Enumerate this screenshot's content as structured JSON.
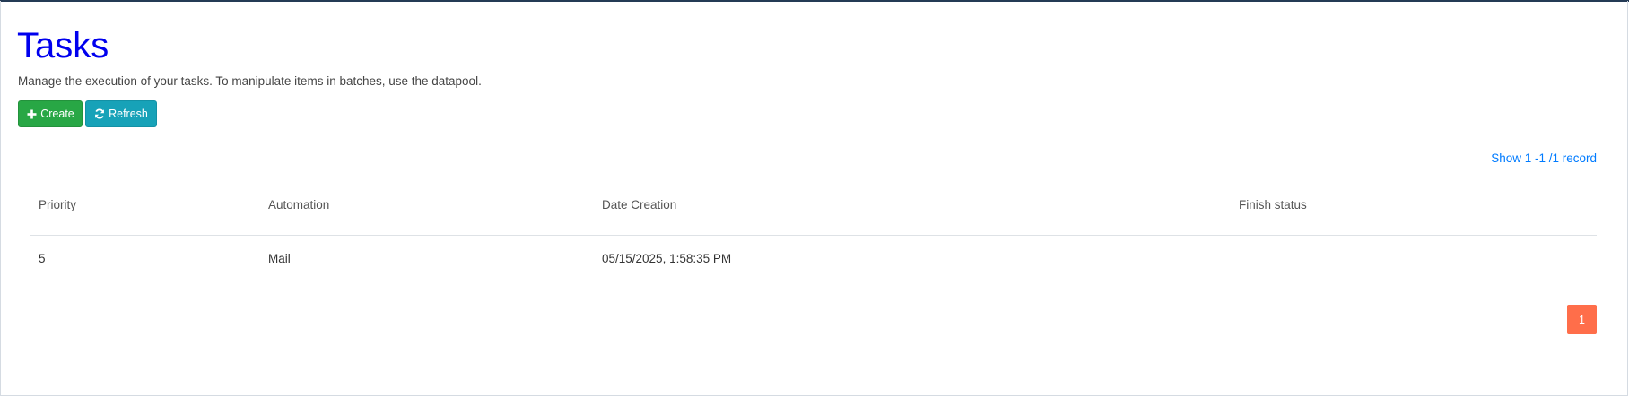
{
  "header": {
    "title": "Tasks",
    "description": "Manage the execution of your tasks. To manipulate items in batches, use the datapool."
  },
  "toolbar": {
    "create_label": "Create",
    "create_icon": "plus-icon",
    "refresh_label": "Refresh",
    "refresh_icon": "refresh-icon"
  },
  "record_info": "Show 1 -1 /1 record",
  "table": {
    "columns": [
      "Priority",
      "Automation",
      "Date Creation",
      "Finish status"
    ],
    "rows": [
      [
        "5",
        "Mail",
        "05/15/2025, 1:58:35 PM",
        ""
      ]
    ]
  },
  "pagination": {
    "current_page": "1"
  },
  "colors": {
    "title": "#0000ee",
    "create_button": "#28a745",
    "refresh_button": "#17a2b8",
    "record_link": "#007bff",
    "page_active": "#ff6e4a"
  }
}
